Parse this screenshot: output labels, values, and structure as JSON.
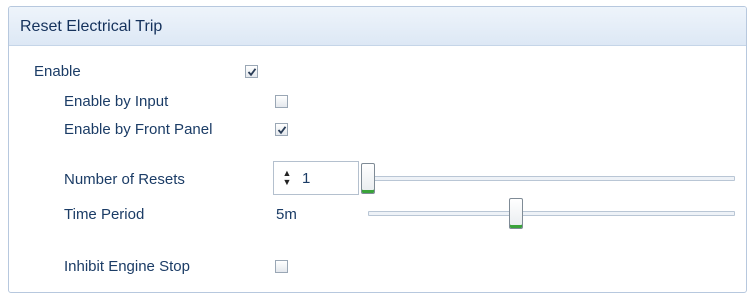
{
  "panel": {
    "title": "Reset Electrical Trip"
  },
  "enable": {
    "label": "Enable",
    "checked": true
  },
  "enable_by_input": {
    "label": "Enable by Input",
    "checked": false
  },
  "enable_by_front_panel": {
    "label": "Enable by Front Panel",
    "checked": true
  },
  "number_of_resets": {
    "label": "Number of Resets",
    "value": "1"
  },
  "time_period": {
    "label": "Time Period",
    "value": "5m"
  },
  "inhibit_engine_stop": {
    "label": "Inhibit Engine Stop",
    "checked": false
  },
  "colors": {
    "header_bg": "#dde8f5",
    "label_text": "#1b3c66",
    "thumb_accent": "#3aa33a"
  }
}
